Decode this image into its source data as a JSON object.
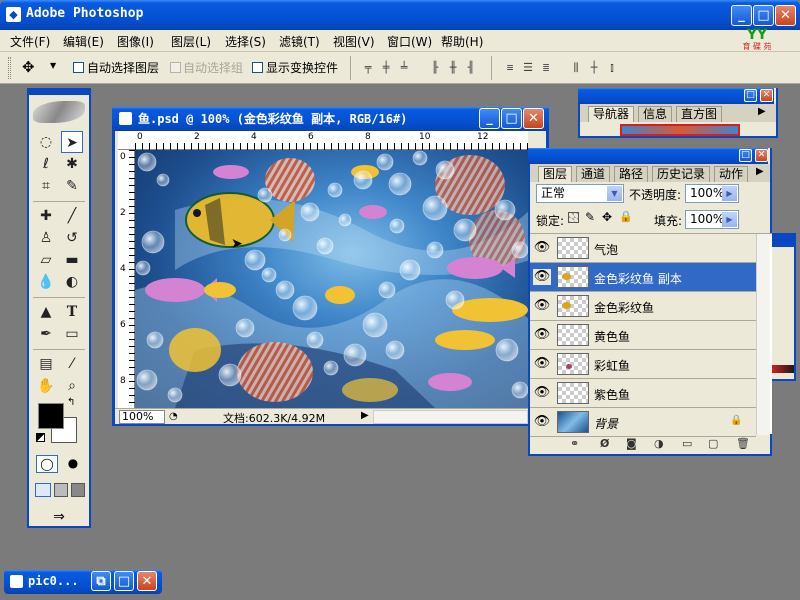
{
  "app": {
    "title": "Adobe Photoshop",
    "logo_label": "YY",
    "logo_sub": "育 碟 苑",
    "accent": "#0a47c2"
  },
  "window_controls": {
    "minimize": "_",
    "maximize": "□",
    "close": "✕"
  },
  "menu": [
    "文件(F)",
    "编辑(E)",
    "图像(I)",
    "图层(L)",
    "选择(S)",
    "滤镜(T)",
    "视图(V)",
    "窗口(W)",
    "帮助(H)"
  ],
  "options_bar": {
    "auto_select_layer": "自动选择图层",
    "auto_select_group": "自动选择组",
    "show_transform": "显示变换控件",
    "auto_select_layer_checked": false,
    "show_transform_checked": false
  },
  "toolbox": {
    "tools": [
      "marquee-tool",
      "move-tool",
      "lasso-tool",
      "magic-wand-tool",
      "crop-tool",
      "slice-tool",
      "healing-brush-tool",
      "brush-tool",
      "clone-stamp-tool",
      "history-brush-tool",
      "eraser-tool",
      "gradient-tool",
      "blur-tool",
      "dodge-tool",
      "path-selection-tool",
      "type-tool",
      "pen-tool",
      "shape-tool",
      "notes-tool",
      "eyedropper-tool",
      "hand-tool",
      "zoom-tool"
    ],
    "foreground_color": "#000000",
    "background_color": "#ffffff"
  },
  "document": {
    "title": "鱼.psd @ 100% (金色彩纹鱼 副本, RGB/16#)",
    "zoom": "100%",
    "status": "文档:602.3K/4.92M",
    "ruler_h": [
      "0",
      "2",
      "4",
      "6",
      "8",
      "10",
      "12"
    ],
    "ruler_v": [
      "0",
      "2",
      "4",
      "6",
      "8"
    ]
  },
  "navigator": {
    "tabs": [
      "导航器",
      "信息",
      "直方图"
    ]
  },
  "layers_panel": {
    "tabs": [
      "图层",
      "通道",
      "路径",
      "历史记录",
      "动作"
    ],
    "blend_mode": "正常",
    "opacity_label": "不透明度:",
    "opacity": "100%",
    "lock_label": "锁定:",
    "fill_label": "填充:",
    "fill": "100%",
    "layers": [
      {
        "name": "气泡",
        "visible": true,
        "selected": false
      },
      {
        "name": "金色彩纹鱼 副本",
        "visible": true,
        "selected": true
      },
      {
        "name": "金色彩纹鱼",
        "visible": true,
        "selected": false
      },
      {
        "name": "黄色鱼",
        "visible": true,
        "selected": false
      },
      {
        "name": "彩虹鱼",
        "visible": true,
        "selected": false
      },
      {
        "name": "紫色鱼",
        "visible": true,
        "selected": false
      },
      {
        "name": "背景",
        "visible": true,
        "selected": false,
        "locked": true
      }
    ]
  },
  "taskbar": {
    "item_label": "pic0..."
  }
}
